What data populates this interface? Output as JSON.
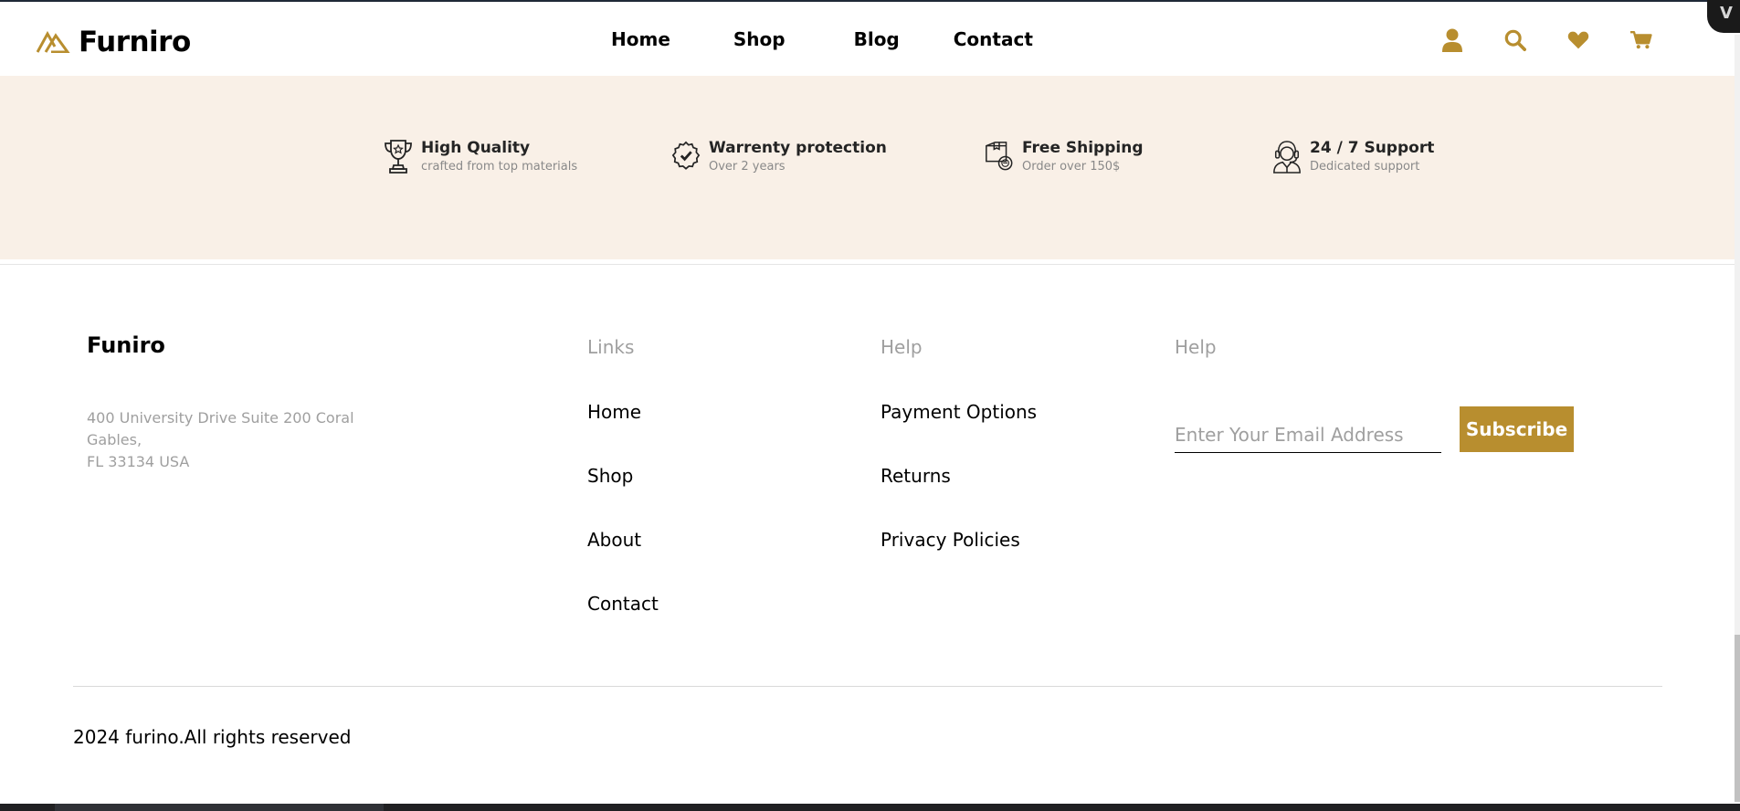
{
  "header": {
    "logo_text": "Furniro",
    "nav": [
      "Home",
      "Shop",
      "Blog",
      "Contact"
    ],
    "icons": [
      "user-icon",
      "search-icon",
      "heart-icon",
      "cart-icon"
    ]
  },
  "features": [
    {
      "title": "High Quality",
      "subtitle": "crafted from top materials",
      "icon": "trophy-icon"
    },
    {
      "title": "Warrenty protection",
      "subtitle": "Over 2 years",
      "icon": "badge-check-icon"
    },
    {
      "title": "Free Shipping",
      "subtitle": "Order over 150$",
      "icon": "shipping-box-icon"
    },
    {
      "title": "24 / 7 Support",
      "subtitle": "Dedicated support",
      "icon": "support-agent-icon"
    }
  ],
  "footer": {
    "brand": "Funiro",
    "address_line1": "400 University Drive Suite 200 Coral",
    "address_line2": "Gables,",
    "address_line3": "FL 33134 USA",
    "links_heading": "Links",
    "links": [
      "Home",
      "Shop",
      "About",
      "Contact"
    ],
    "help_heading": "Help",
    "help_links": [
      "Payment Options",
      "Returns",
      "Privacy Policies"
    ],
    "newsletter_heading": "Help",
    "email_placeholder": "Enter Your Email Address",
    "subscribe_label": "Subscribe",
    "copyright": "2024 furino.All rights reserved"
  },
  "colors": {
    "accent": "#b88e2f",
    "band_background": "#f9f0e7",
    "muted_text": "#9f9f9f"
  }
}
